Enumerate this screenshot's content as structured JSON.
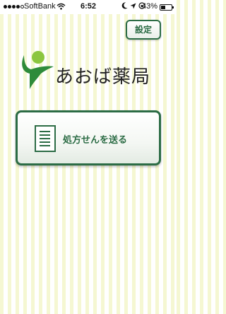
{
  "status_bar": {
    "carrier": "SoftBank",
    "time": "6:52",
    "battery_percent": "43%",
    "battery_level": 0.43,
    "signal_bars": 4
  },
  "header": {
    "settings_label": "設定"
  },
  "logo": {
    "name": "あおば薬局"
  },
  "main": {
    "send_prescription_label": "処方せんを送る"
  },
  "colors": {
    "accent": "#2c6c45",
    "logo_green": "#2e8b3a",
    "logo_lime": "#8cc63f",
    "stripe": "#f5f7d2"
  },
  "icons": [
    "signal-dots-icon",
    "wifi-icon",
    "moon-icon",
    "location-arrow-icon",
    "orientation-lock-icon",
    "battery-icon",
    "document-icon"
  ]
}
